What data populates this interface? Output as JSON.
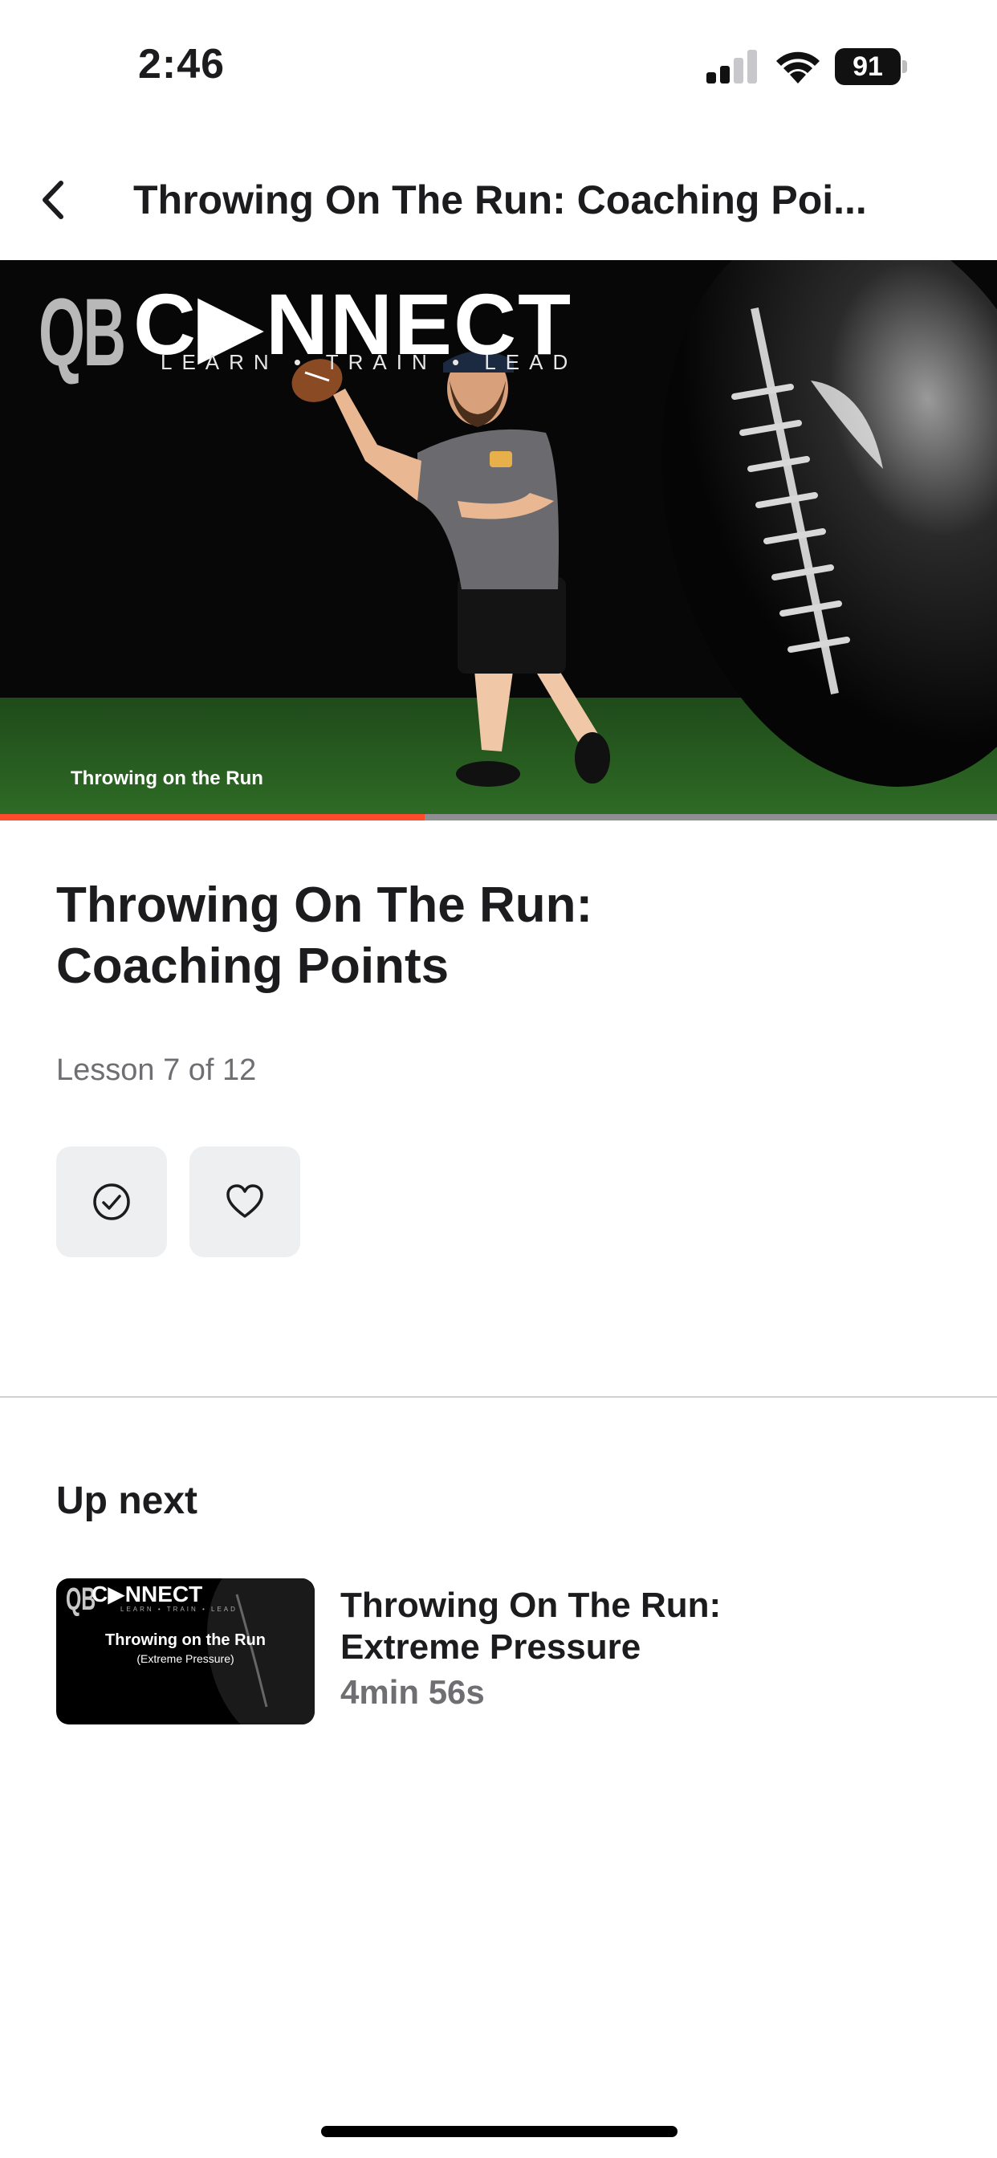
{
  "status_bar": {
    "time": "2:46",
    "battery": "91"
  },
  "nav": {
    "title": "Throwing On The Run: Coaching Poi..."
  },
  "video": {
    "logo_prefix": "QB",
    "logo_brand": "C▶NNECT",
    "logo_tagline": "LEARN • TRAIN • LEAD",
    "caption": "Throwing on the Run",
    "progress": 0.426,
    "progress_color": "#ff4b2b"
  },
  "lesson": {
    "title_line1": "Throwing On The Run:",
    "title_line2": "Coaching Points",
    "count": "Lesson 7 of 12",
    "complete_icon": "check-circle-icon",
    "favorite_icon": "heart-icon"
  },
  "up_next": {
    "heading": "Up next",
    "item": {
      "thumb_prefix": "QB",
      "thumb_brand": "C▶NNECT",
      "thumb_tagline": "LEARN • TRAIN • LEAD",
      "thumb_title": "Throwing on the Run",
      "thumb_subtitle": "(Extreme Pressure)",
      "title_line1": "Throwing On The Run:",
      "title_line2": "Extreme Pressure",
      "duration": "4min 56s"
    }
  }
}
